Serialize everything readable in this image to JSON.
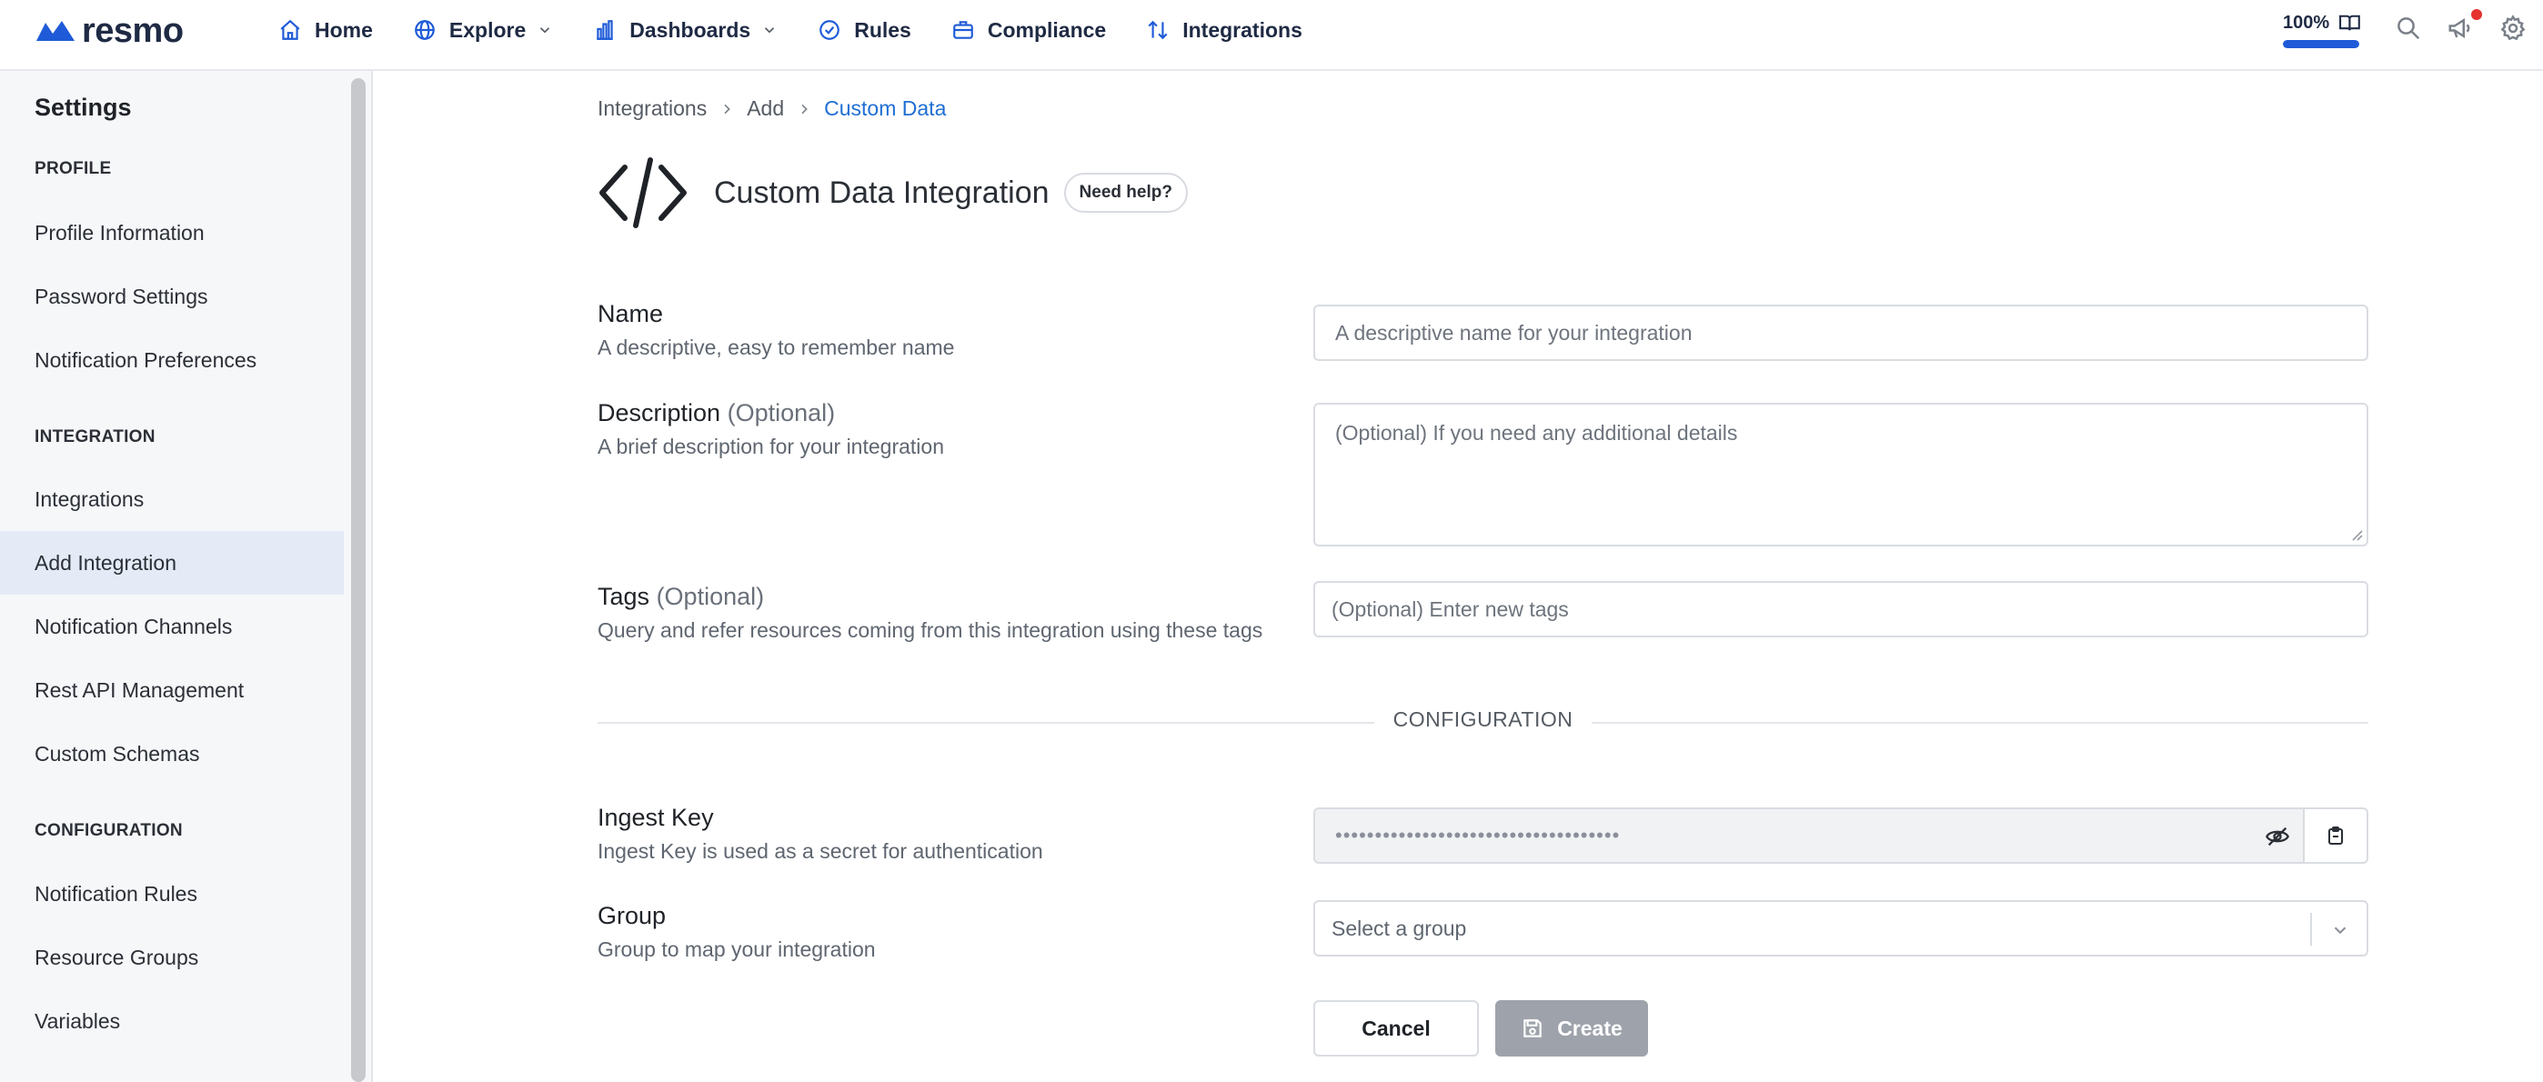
{
  "brand": {
    "name": "resmo",
    "color": "#1f5bd8"
  },
  "nav": {
    "items": [
      {
        "label": "Home",
        "icon": "home-icon"
      },
      {
        "label": "Explore",
        "icon": "globe-icon",
        "dropdown": true
      },
      {
        "label": "Dashboards",
        "icon": "bar-chart-icon",
        "dropdown": true
      },
      {
        "label": "Rules",
        "icon": "check-circle-icon"
      },
      {
        "label": "Compliance",
        "icon": "briefcase-icon"
      },
      {
        "label": "Integrations",
        "icon": "arrows-swap-icon"
      }
    ]
  },
  "topright": {
    "usage_label": "100%",
    "usage_fraction": 1.0,
    "icons": [
      "book-icon",
      "search-icon",
      "megaphone-icon",
      "gear-icon"
    ],
    "notification_color": "#e5322d"
  },
  "sidebar": {
    "title": "Settings",
    "sections": [
      {
        "heading": "PROFILE",
        "items": [
          "Profile Information",
          "Password Settings",
          "Notification Preferences"
        ]
      },
      {
        "heading": "INTEGRATION",
        "items": [
          "Integrations",
          "Add Integration",
          "Notification Channels",
          "Rest API Management",
          "Custom Schemas"
        ]
      },
      {
        "heading": "CONFIGURATION",
        "items": [
          "Notification Rules",
          "Resource Groups",
          "Variables"
        ]
      }
    ],
    "active_item": "Add Integration"
  },
  "breadcrumb": [
    "Integrations",
    "Add",
    "Custom Data"
  ],
  "header": {
    "title": "Custom Data Integration",
    "help_label": "Need help?",
    "icon": "code-icon"
  },
  "form": {
    "name": {
      "label": "Name",
      "description": "A descriptive, easy to remember name",
      "placeholder": "A descriptive name for your integration"
    },
    "description": {
      "label": "Description",
      "optional": "(Optional)",
      "description": "A brief description for your integration",
      "placeholder": "(Optional) If you need any additional details"
    },
    "tags": {
      "label": "Tags",
      "optional": "(Optional)",
      "description": "Query and refer resources coming from this integration using these tags",
      "placeholder": "(Optional) Enter new tags"
    },
    "section_heading": "CONFIGURATION",
    "ingest_key": {
      "label": "Ingest Key",
      "description": "Ingest Key is used as a secret for authentication",
      "masked_value": "••••••••••••••••••••••••••••••••••••"
    },
    "group": {
      "label": "Group",
      "description": "Group to map your integration",
      "placeholder": "Select a group"
    },
    "cancel_label": "Cancel",
    "create_label": "Create"
  },
  "colors": {
    "accent": "#1f6ed4",
    "active_bg": "#e4ebf6",
    "disabled_btn": "#9ea3ab"
  }
}
